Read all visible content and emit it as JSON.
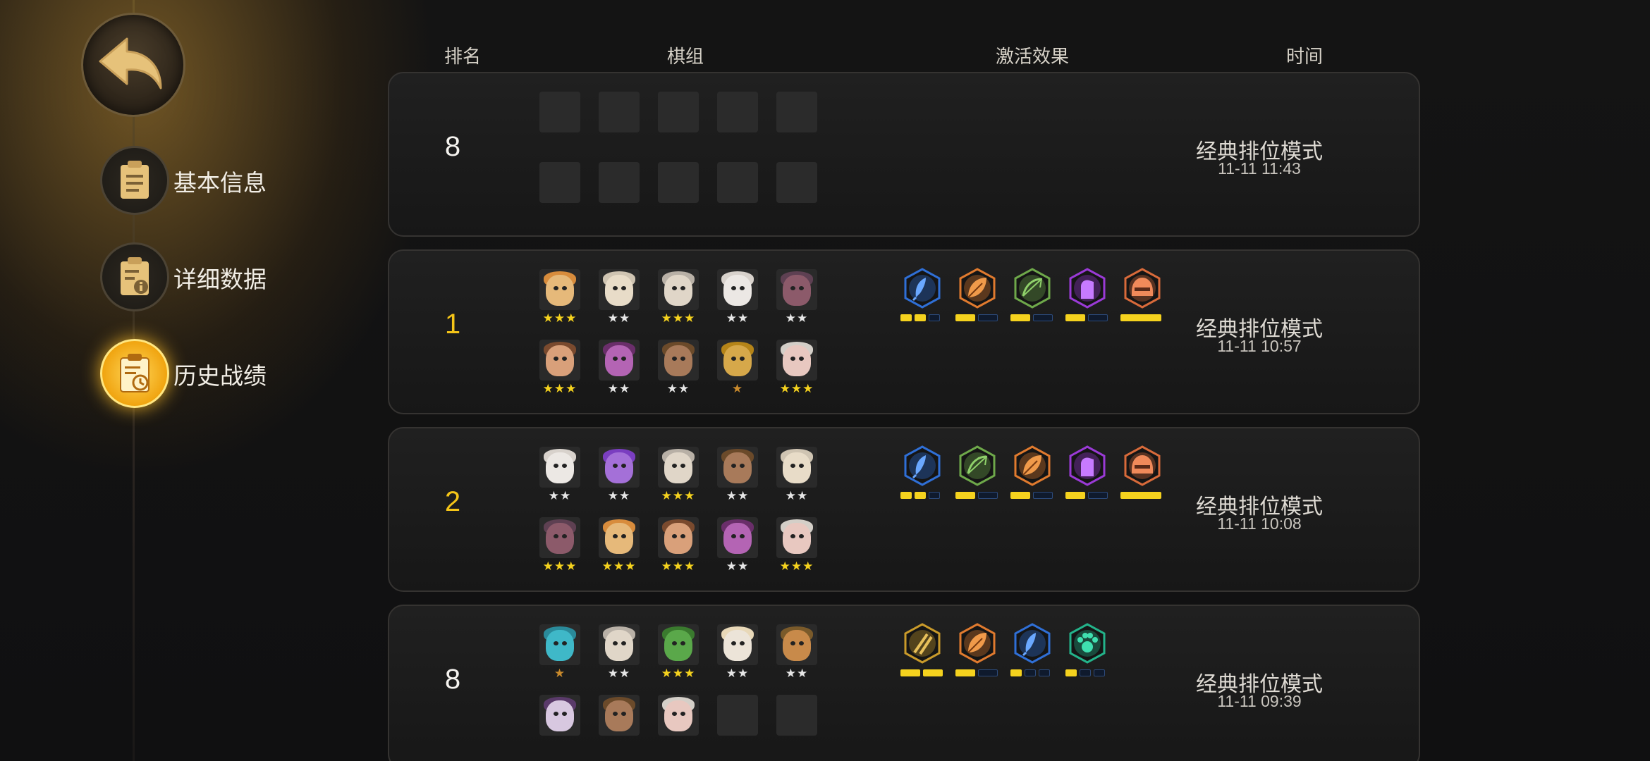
{
  "header": {
    "col_rank": "排名",
    "col_lineup": "棋组",
    "col_synergy": "激活效果",
    "col_time": "时间"
  },
  "sidebar": {
    "back_icon": "back-arrow-icon",
    "items": [
      {
        "label": "基本信息",
        "icon": "clipboard-icon",
        "active": false
      },
      {
        "label": "详细数据",
        "icon": "clipboard-info-icon",
        "active": false
      },
      {
        "label": "历史战绩",
        "icon": "clipboard-clock-icon",
        "active": true
      }
    ]
  },
  "colors": {
    "gold": "#f5c518",
    "star_gold": "#f5d21e",
    "panel": "#1b1b1b"
  },
  "matches": [
    {
      "rank": "8",
      "rank_gold": false,
      "mode": "经典排位模式",
      "time": "11-11 11:43",
      "units": [
        {
          "empty": true
        },
        {
          "empty": true
        },
        {
          "empty": true
        },
        {
          "empty": true
        },
        {
          "empty": true
        },
        {
          "empty": true
        },
        {
          "empty": true
        },
        {
          "empty": true
        },
        {
          "empty": true
        },
        {
          "empty": true
        }
      ],
      "synergies": []
    },
    {
      "rank": "1",
      "rank_gold": true,
      "mode": "经典排位模式",
      "time": "11-11 10:57",
      "units": [
        {
          "stars": 3,
          "color": "#e6b97a",
          "hat": "#d88c3c"
        },
        {
          "stars": 2,
          "color": "#e8dcc8",
          "hat": "#cfc4b2"
        },
        {
          "stars": 3,
          "color": "#e0d6c8",
          "hat": "#b8b0a6"
        },
        {
          "stars": 2,
          "color": "#ece8e4",
          "hat": "#d8d2cc"
        },
        {
          "stars": 2,
          "color": "#8c5a6a",
          "hat": "#5e4052"
        },
        {
          "stars": 3,
          "color": "#d9a07a",
          "hat": "#7a4a2e"
        },
        {
          "stars": 2,
          "color": "#b464b4",
          "hat": "#6a2e6a"
        },
        {
          "stars": 2,
          "color": "#a87a5a",
          "hat": "#6b4a2a"
        },
        {
          "stars": 1,
          "color": "#d6a84a",
          "hat": "#b58418"
        },
        {
          "stars": 3,
          "color": "#e8c8c0",
          "hat": "#d4cfc8"
        }
      ],
      "synergies": [
        {
          "icon": "blue-feather-icon",
          "color": "#2f6fd6",
          "bars": [
            1,
            1,
            0
          ]
        },
        {
          "icon": "orange-leaf-icon",
          "color": "#e07a2e",
          "bars": [
            1,
            0
          ]
        },
        {
          "icon": "green-bow-icon",
          "color": "#6ea84a",
          "bars": [
            1,
            0
          ]
        },
        {
          "icon": "purple-hand-icon",
          "color": "#9a3ad6",
          "bars": [
            1,
            0
          ]
        },
        {
          "icon": "orange-helmet-icon",
          "color": "#d86a3a",
          "bars": [
            1
          ]
        }
      ]
    },
    {
      "rank": "2",
      "rank_gold": true,
      "mode": "经典排位模式",
      "time": "11-11 10:08",
      "units": [
        {
          "stars": 2,
          "color": "#ece8e4",
          "hat": "#d8d2cc"
        },
        {
          "stars": 2,
          "color": "#a470d8",
          "hat": "#7a3ec0"
        },
        {
          "stars": 3,
          "color": "#e0d6c8",
          "hat": "#b8b0a6"
        },
        {
          "stars": 2,
          "color": "#a87a5a",
          "hat": "#6b4a2a"
        },
        {
          "stars": 2,
          "color": "#e8dcc8",
          "hat": "#cfc4b2"
        },
        {
          "stars": 3,
          "color": "#8c5a6a",
          "hat": "#5e4052"
        },
        {
          "stars": 3,
          "color": "#e6b97a",
          "hat": "#d88c3c"
        },
        {
          "stars": 3,
          "color": "#d9a07a",
          "hat": "#7a4a2e"
        },
        {
          "stars": 2,
          "color": "#b464b4",
          "hat": "#6a2e6a"
        },
        {
          "stars": 3,
          "color": "#e8c8c0",
          "hat": "#d4cfc8"
        }
      ],
      "synergies": [
        {
          "icon": "blue-feather-icon",
          "color": "#2f6fd6",
          "bars": [
            1,
            1,
            0
          ]
        },
        {
          "icon": "green-bow-icon",
          "color": "#6ea84a",
          "bars": [
            1,
            0
          ]
        },
        {
          "icon": "orange-leaf-icon",
          "color": "#e07a2e",
          "bars": [
            1,
            0
          ]
        },
        {
          "icon": "purple-hand-icon",
          "color": "#9a3ad6",
          "bars": [
            1,
            0
          ]
        },
        {
          "icon": "orange-helmet-icon",
          "color": "#d86a3a",
          "bars": [
            1
          ]
        }
      ]
    },
    {
      "rank": "8",
      "rank_gold": false,
      "mode": "经典排位模式",
      "time": "11-11 09:39",
      "units": [
        {
          "stars": 1,
          "color": "#3fb8c8",
          "hat": "#2a8a9a"
        },
        {
          "stars": 2,
          "color": "#e0d6c8",
          "hat": "#b8b0a6"
        },
        {
          "stars": 3,
          "color": "#5aa84a",
          "hat": "#3a7a2e"
        },
        {
          "stars": 2,
          "color": "#ece4d8",
          "hat": "#e8d8b8"
        },
        {
          "stars": 2,
          "color": "#c88a4a",
          "hat": "#7a5a2a"
        },
        {
          "stars": 0,
          "color": "#d8c8e0",
          "hat": "#5a3a6a"
        },
        {
          "stars": 0,
          "color": "#a87a5a",
          "hat": "#6b4a2a"
        },
        {
          "stars": 0,
          "color": "#e8c8c0",
          "hat": "#d4cfc8"
        },
        {
          "empty": true
        },
        {
          "empty": true
        }
      ],
      "synergies": [
        {
          "icon": "gold-daggers-icon",
          "color": "#c99a2a",
          "bars": [
            1,
            1
          ]
        },
        {
          "icon": "orange-leaf-icon",
          "color": "#e07a2e",
          "bars": [
            1,
            0
          ]
        },
        {
          "icon": "blue-feather-icon",
          "color": "#2f6fd6",
          "bars": [
            1,
            0,
            0
          ]
        },
        {
          "icon": "teal-paw-icon",
          "color": "#23b38a",
          "bars": [
            1,
            0,
            0
          ]
        }
      ]
    }
  ]
}
